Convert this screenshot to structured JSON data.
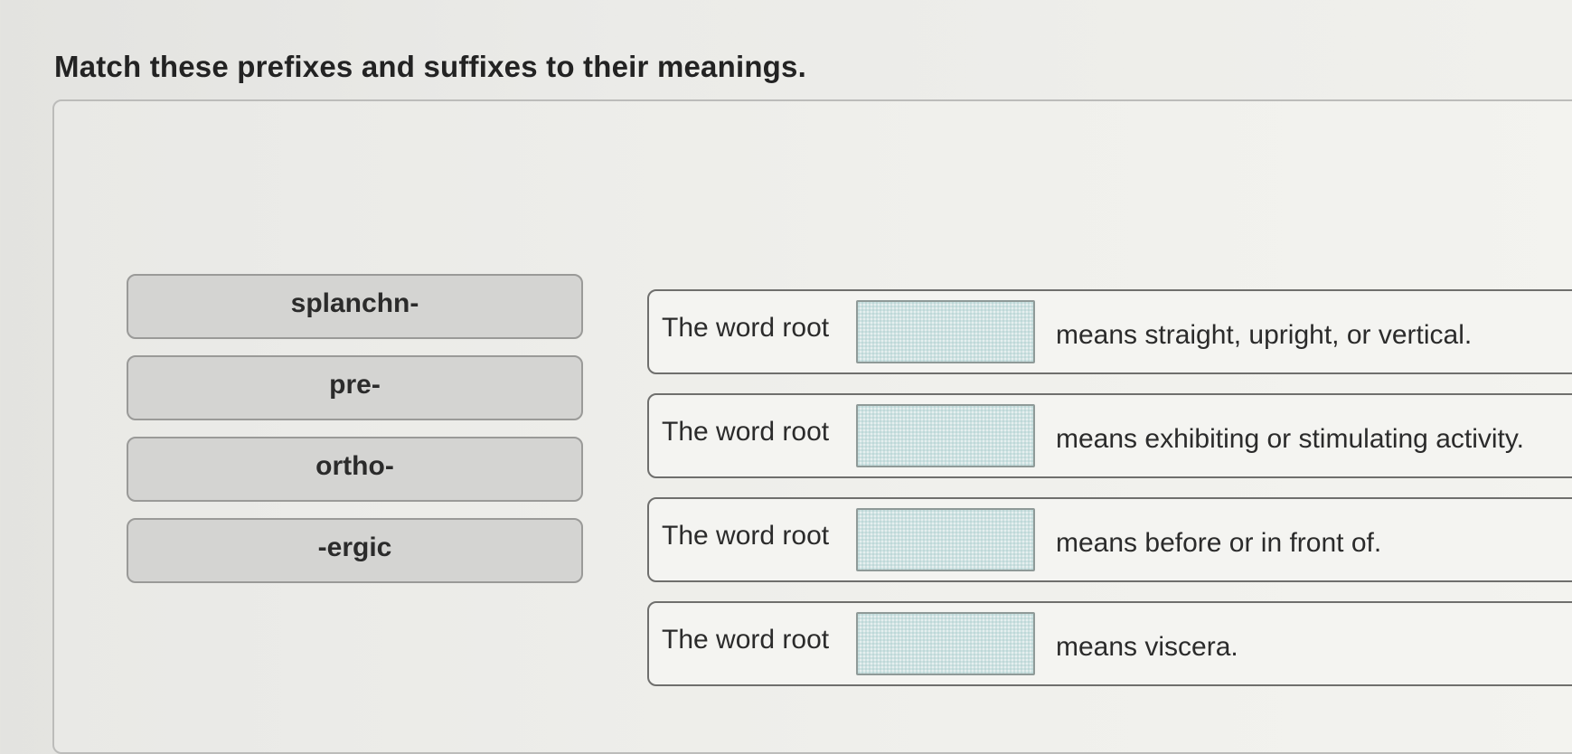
{
  "question": {
    "title": "Match these prefixes and suffixes to their meanings."
  },
  "choices": [
    {
      "label": "splanchn-"
    },
    {
      "label": "pre-"
    },
    {
      "label": "ortho-"
    },
    {
      "label": "-ergic"
    }
  ],
  "statements": [
    {
      "prefix": "The word root",
      "meaning": "means straight, upright, or vertical."
    },
    {
      "prefix": "The word root",
      "meaning": "means exhibiting or stimulating activity."
    },
    {
      "prefix": "The word root",
      "meaning": "means before or in front of."
    },
    {
      "prefix": "The word root",
      "meaning": "means viscera."
    }
  ]
}
